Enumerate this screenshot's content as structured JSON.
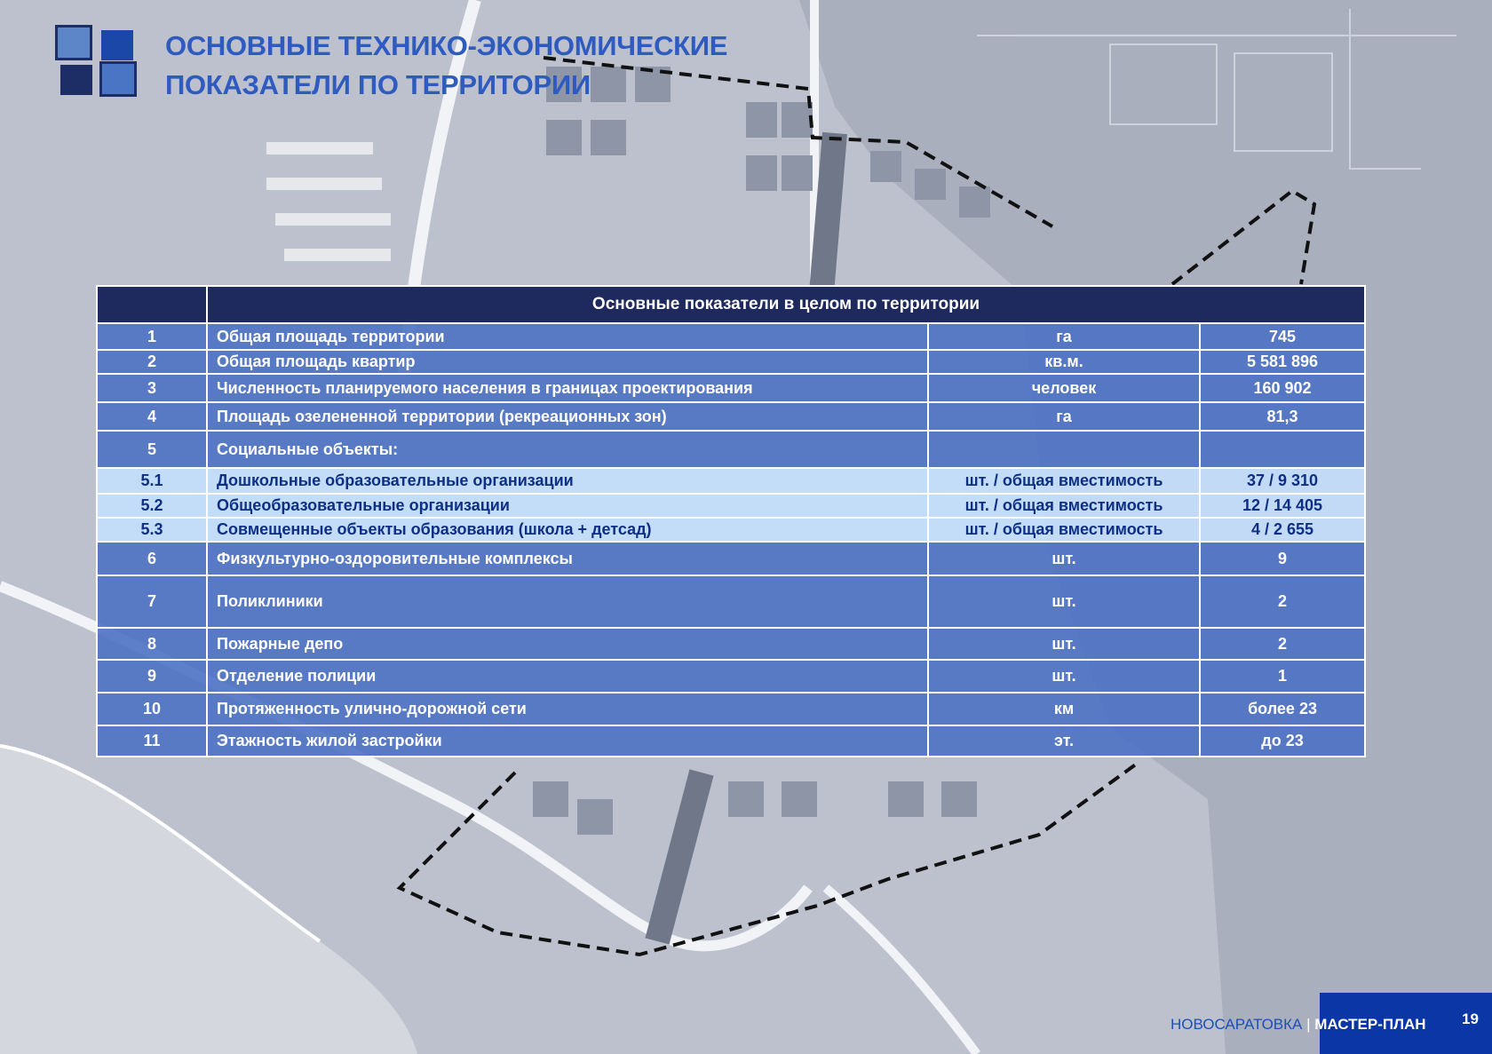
{
  "header": {
    "title_line1": "ОСНОВНЫЕ ТЕХНИКО-ЭКОНОМИЧЕСКИЕ",
    "title_line2": "ПОКАЗАТЕЛИ ПО ТЕРРИТОРИИ"
  },
  "table": {
    "heading": "Основные показатели в целом по территории",
    "rows": [
      {
        "num": "1",
        "name": "Общая площадь территории",
        "unit": "га",
        "value": "745"
      },
      {
        "num": "2",
        "name": "Общая площадь квартир",
        "unit": "кв.м.",
        "value": "5 581 896"
      },
      {
        "num": "3",
        "name": "Численность планируемого населения в границах проектирования",
        "unit": "человек",
        "value": "160 902"
      },
      {
        "num": "4",
        "name": "Площадь озелененной территории (рекреационных зон)",
        "unit": "га",
        "value": "81,3"
      },
      {
        "num": "5",
        "name": "Социальные объекты:",
        "unit": "",
        "value": ""
      },
      {
        "num": "5.1",
        "name": "Дошкольные образовательные организации",
        "unit": "шт. / общая вместимость",
        "value": "37 / 9 310"
      },
      {
        "num": "5.2",
        "name": "Общеобразовательные организации",
        "unit": "шт. / общая вместимость",
        "value": "12 / 14 405"
      },
      {
        "num": "5.3",
        "name": "Совмещенные объекты образования (школа + детсад)",
        "unit": "шт. / общая вместимость",
        "value": "4 / 2 655"
      },
      {
        "num": "6",
        "name": "Физкультурно-оздоровительные комплексы",
        "unit": "шт.",
        "value": "9"
      },
      {
        "num": "7",
        "name": "Поликлиники",
        "unit": "шт.",
        "value": "2"
      },
      {
        "num": "8",
        "name": "Пожарные депо",
        "unit": "шт.",
        "value": "2"
      },
      {
        "num": "9",
        "name": "Отделение полиции",
        "unit": "шт.",
        "value": "1"
      },
      {
        "num": "10",
        "name": "Протяженность улично-дорожной сети",
        "unit": "км",
        "value": "более 23"
      },
      {
        "num": "11",
        "name": "Этажность жилой застройки",
        "unit": "эт.",
        "value": "до 23"
      }
    ]
  },
  "footer": {
    "place": "НОВОСАРАТОВКА",
    "separator": "|",
    "doc": "МАСТЕР-ПЛАН",
    "page": "19"
  }
}
